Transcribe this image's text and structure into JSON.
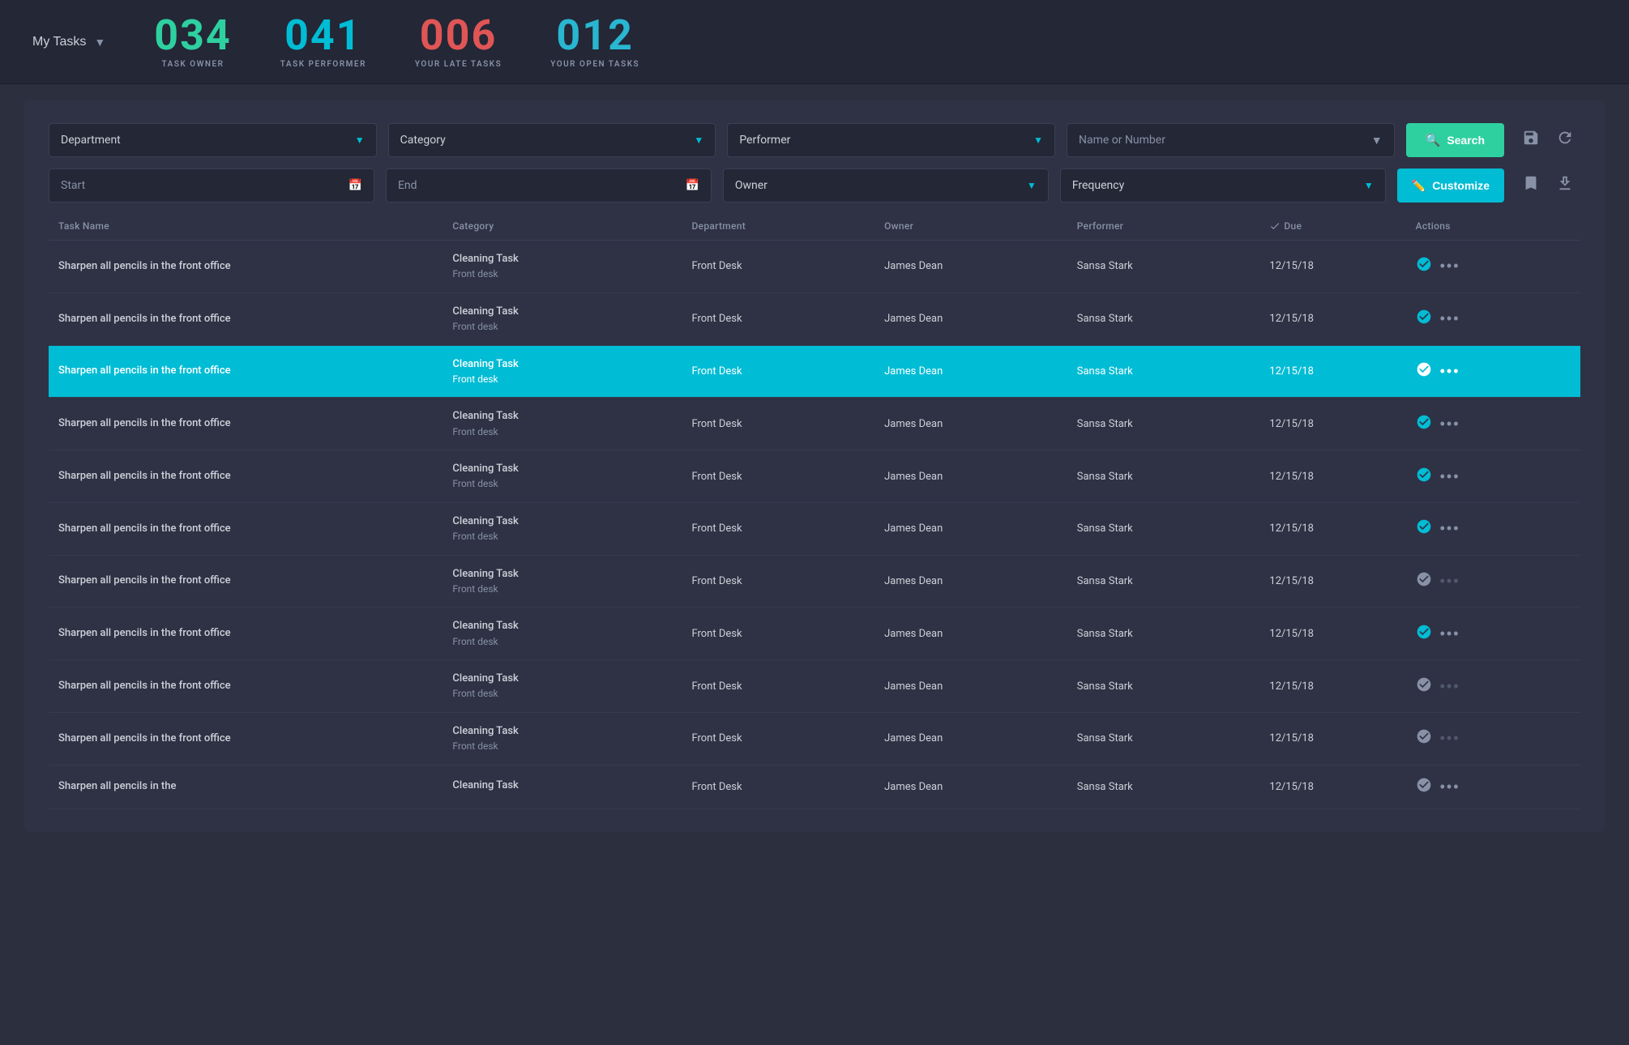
{
  "header": {
    "my_tasks_label": "My Tasks",
    "stats": [
      {
        "number": "034",
        "label": "TASK OWNER",
        "color": "green"
      },
      {
        "number": "041",
        "label": "TASK PERFORMER",
        "color": "cyan"
      },
      {
        "number": "006",
        "label": "YOUR LATE TASKS",
        "color": "red"
      },
      {
        "number": "012",
        "label": "YOUR OPEN TASKS",
        "color": "blue"
      }
    ]
  },
  "filters": {
    "department_label": "Department",
    "category_label": "Category",
    "performer_label": "Performer",
    "name_or_number_label": "Name or Number",
    "search_label": "Search",
    "start_label": "Start",
    "end_label": "End",
    "owner_label": "Owner",
    "frequency_label": "Frequency",
    "customize_label": "Customize"
  },
  "table": {
    "headers": [
      {
        "key": "task_name",
        "label": "Task Name"
      },
      {
        "key": "category",
        "label": "Category"
      },
      {
        "key": "department",
        "label": "Department"
      },
      {
        "key": "owner",
        "label": "Owner"
      },
      {
        "key": "performer",
        "label": "Performer"
      },
      {
        "key": "due",
        "label": "Due"
      },
      {
        "key": "actions",
        "label": "Actions"
      }
    ],
    "rows": [
      {
        "id": 1,
        "task": "Sharpen all pencils in the front office",
        "category": "Cleaning Task",
        "category2": "Front desk",
        "department": "Front Desk",
        "owner": "James Dean",
        "performer": "Sansa Stark",
        "due": "12/15/18",
        "selected": false,
        "check_active": true,
        "dots_dimmed": false
      },
      {
        "id": 2,
        "task": "Sharpen all pencils in the front office",
        "category": "Cleaning Task",
        "category2": "Front desk",
        "department": "Front Desk",
        "owner": "James Dean",
        "performer": "Sansa Stark",
        "due": "12/15/18",
        "selected": false,
        "check_active": true,
        "dots_dimmed": false
      },
      {
        "id": 3,
        "task": "Sharpen all pencils in the front office",
        "category": "Cleaning Task",
        "category2": "Front desk",
        "department": "Front Desk",
        "owner": "James Dean",
        "performer": "Sansa Stark",
        "due": "12/15/18",
        "selected": true,
        "check_active": true,
        "dots_dimmed": false
      },
      {
        "id": 4,
        "task": "Sharpen all pencils in the front office",
        "category": "Cleaning Task",
        "category2": "Front desk",
        "department": "Front Desk",
        "owner": "James Dean",
        "performer": "Sansa Stark",
        "due": "12/15/18",
        "selected": false,
        "check_active": true,
        "dots_dimmed": false
      },
      {
        "id": 5,
        "task": "Sharpen all pencils in the front office",
        "category": "Cleaning Task",
        "category2": "Front desk",
        "department": "Front Desk",
        "owner": "James Dean",
        "performer": "Sansa Stark",
        "due": "12/15/18",
        "selected": false,
        "check_active": true,
        "dots_dimmed": false
      },
      {
        "id": 6,
        "task": "Sharpen all pencils in the front office",
        "category": "Cleaning Task",
        "category2": "Front desk",
        "department": "Front Desk",
        "owner": "James Dean",
        "performer": "Sansa Stark",
        "due": "12/15/18",
        "selected": false,
        "check_active": true,
        "dots_dimmed": false
      },
      {
        "id": 7,
        "task": "Sharpen all pencils in the front office",
        "category": "Cleaning Task",
        "category2": "Front desk",
        "department": "Front Desk",
        "owner": "James Dean",
        "performer": "Sansa Stark",
        "due": "12/15/18",
        "selected": false,
        "check_active": false,
        "dots_dimmed": true
      },
      {
        "id": 8,
        "task": "Sharpen all pencils in the front office",
        "category": "Cleaning Task",
        "category2": "Front desk",
        "department": "Front Desk",
        "owner": "James Dean",
        "performer": "Sansa Stark",
        "due": "12/15/18",
        "selected": false,
        "check_active": true,
        "dots_dimmed": false
      },
      {
        "id": 9,
        "task": "Sharpen all pencils in the front office",
        "category": "Cleaning Task",
        "category2": "Front desk",
        "department": "Front Desk",
        "owner": "James Dean",
        "performer": "Sansa Stark",
        "due": "12/15/18",
        "selected": false,
        "check_active": false,
        "dots_dimmed": true
      },
      {
        "id": 10,
        "task": "Sharpen all pencils in the front office",
        "category": "Cleaning Task",
        "category2": "Front desk",
        "department": "Front Desk",
        "owner": "James Dean",
        "performer": "Sansa Stark",
        "due": "12/15/18",
        "selected": false,
        "check_active": false,
        "dots_dimmed": true
      },
      {
        "id": 11,
        "task": "Sharpen all pencils in the",
        "category": "Cleaning Task",
        "category2": "",
        "department": "Front Desk",
        "owner": "James Dean",
        "performer": "Sansa Stark",
        "due": "12/15/18",
        "selected": false,
        "check_active": false,
        "dots_dimmed": false
      }
    ]
  }
}
